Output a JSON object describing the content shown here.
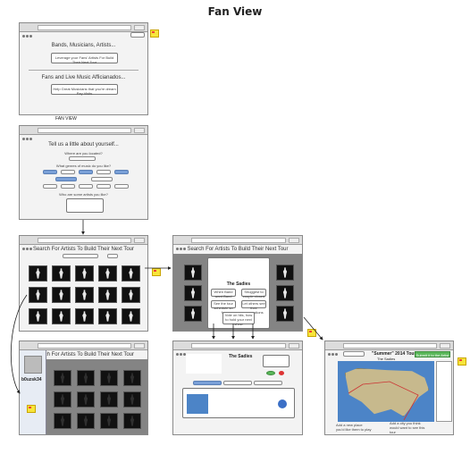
{
  "title": "Fan View",
  "screen1": {
    "band_heading": "Bands, Musicians, Artists...",
    "band_text": "Leverage your Fans' Artists For Build Their Next Tour",
    "fan_heading": "Fans and Live Music Afficianados...",
    "fan_text": "Help Great Musicians that you're dream Pay Visits"
  },
  "fan_view_label": "FAN VIEW",
  "screen2": {
    "heading": "Tell us a little about yourself...",
    "q_location": "Where are you located?",
    "q_genres": "What genres of music do you like?",
    "q_artists": "Who are some artists you like?"
  },
  "screen3": {
    "heading": "Search For Artists To Build Their Next Tour"
  },
  "screen4": {
    "heading": "Search For Artists To Build Their Next Tour",
    "artist": "The Sadies",
    "options": [
      "When Band want Band",
      "Shuggest to couple closed",
      "See the tour schedule so far",
      "Let others see their suggestions",
      "Vote on hits, how to hold your next show"
    ]
  },
  "screen5": {
    "heading": "Search For Artists To Build Their Next Tour",
    "username": "b0uzsk34"
  },
  "screen6": {
    "artist": "The Sadies"
  },
  "screen7": {
    "title": "\"Summer\" 2014 Tour",
    "subtitle": "The Sadies",
    "submit": "Submit it to the Artist",
    "caption_left": "Add a new place you'd like them to play",
    "caption_right": "Add a city you think would want to see this tour"
  }
}
